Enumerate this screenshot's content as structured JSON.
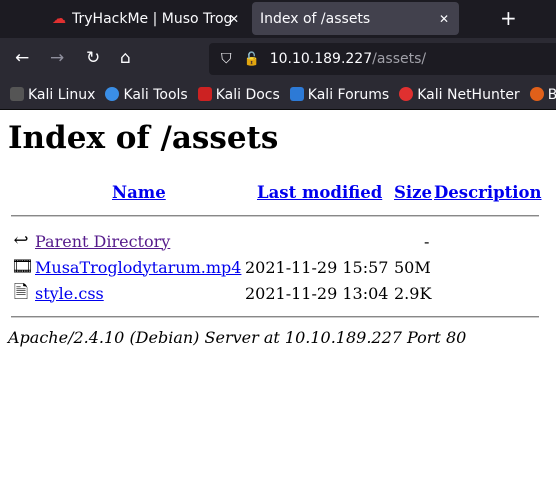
{
  "browser": {
    "tabs": [
      {
        "title": "TryHackMe | Muso Troglodytarum",
        "active": false
      },
      {
        "title": "Index of /assets",
        "active": true
      }
    ],
    "url_host": "10.10.189.227",
    "url_path": "/assets/",
    "bookmarks": [
      {
        "label": "Kali Linux",
        "color": "#1c1b22"
      },
      {
        "label": "Kali Tools",
        "color": "#3a8ee6"
      },
      {
        "label": "Kali Docs",
        "color": "#cc2222"
      },
      {
        "label": "Kali Forums",
        "color": "#2d7ad6"
      },
      {
        "label": "Kali NetHunter",
        "color": "#e03030"
      },
      {
        "label": "B",
        "color": "#e0601a"
      }
    ]
  },
  "page": {
    "title": "Index of /assets",
    "headers": {
      "name": "Name",
      "modified": "Last modified",
      "size": "Size",
      "description": "Description"
    },
    "rows": [
      {
        "icon": "back-icon",
        "name": "Parent Directory",
        "modified": "",
        "size": "-",
        "visited": true
      },
      {
        "icon": "movie-icon",
        "name": "MusaTroglodytarum.mp4",
        "modified": "2021-11-29 15:57",
        "size": "50M"
      },
      {
        "icon": "text-file-icon",
        "name": "style.css",
        "modified": "2021-11-29 13:04",
        "size": "2.9K"
      }
    ],
    "address": "Apache/2.4.10 (Debian) Server at 10.10.189.227 Port 80"
  }
}
